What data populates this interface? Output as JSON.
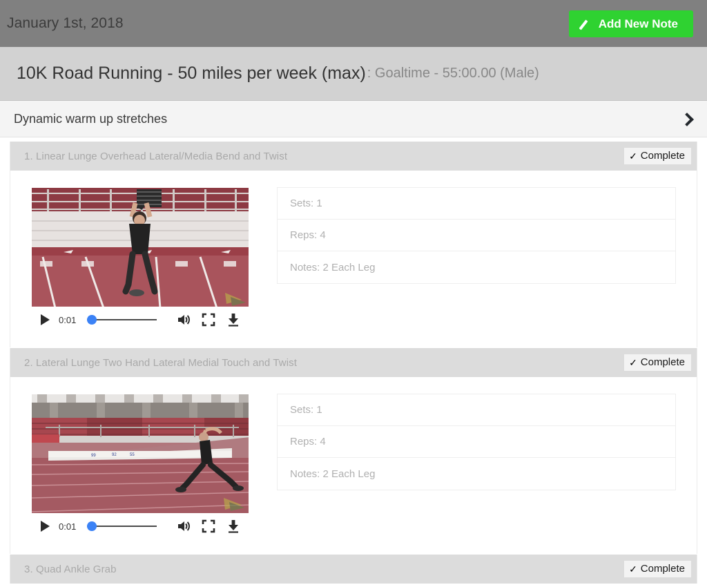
{
  "topbar": {
    "date": "January 1st, 2018",
    "add_note_label": "Add New Note",
    "pencil_icon": "pencil-icon",
    "button_color": "#2fd231",
    "bar_color": "#808080"
  },
  "program": {
    "title": "10K Road Running - 50 miles per week (max)",
    "goal": ": Goaltime - 55:00.00 (Male)",
    "band_color": "#d2d2d2"
  },
  "section": {
    "title": "Dynamic warm up stretches",
    "chevron_icon": "chevron-right-icon",
    "expanded": "false"
  },
  "exercises": [
    {
      "name": "1. Linear Lunge Overhead Lateral/Media Bend and Twist",
      "complete_label": "Complete",
      "check_icon": "check-icon",
      "video": {
        "time": "0:01",
        "play_icon": "play-icon",
        "volume_icon": "volume-icon",
        "fullscreen_icon": "fullscreen-icon",
        "download_icon": "download-icon",
        "progress_percent": 0,
        "scene": "athlete-overhead-lunge-on-red-track"
      },
      "details": [
        "Sets: 1",
        "Reps: 4",
        "Notes: 2 Each Leg"
      ]
    },
    {
      "name": "2. Lateral Lunge Two Hand Lateral Medial Touch and Twist",
      "complete_label": "Complete",
      "check_icon": "check-icon",
      "video": {
        "time": "0:01",
        "play_icon": "play-icon",
        "volume_icon": "volume-icon",
        "fullscreen_icon": "fullscreen-icon",
        "download_icon": "download-icon",
        "progress_percent": 0,
        "scene": "athlete-lateral-lunge-on-red-track"
      },
      "details": [
        "Sets: 1",
        "Reps: 4",
        "Notes: 2 Each Leg"
      ]
    },
    {
      "name": "3. Quad Ankle Grab",
      "complete_label": "Complete",
      "check_icon": "check-icon",
      "video": null,
      "details": []
    }
  ]
}
